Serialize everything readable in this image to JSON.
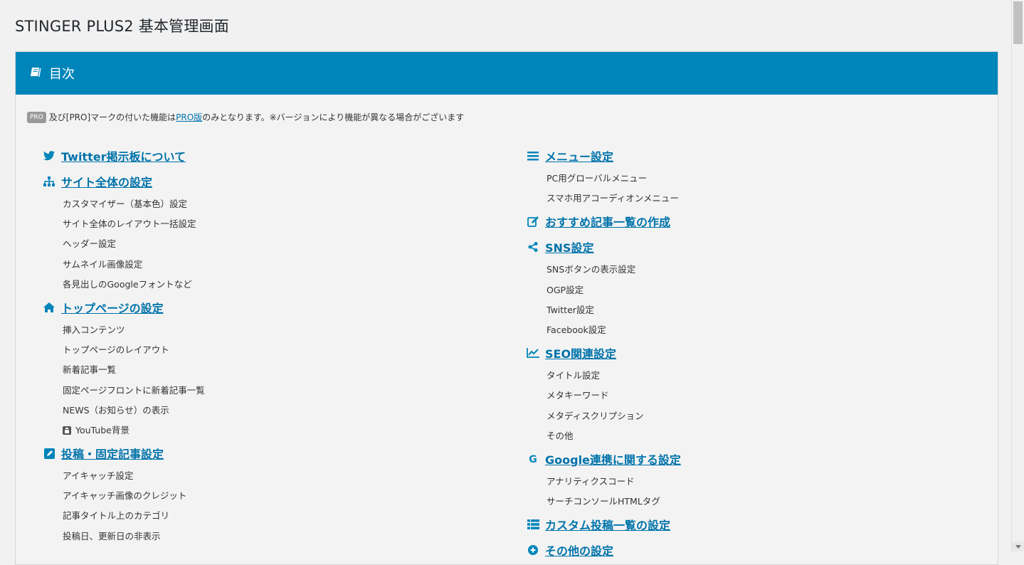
{
  "title": "STINGER PLUS2 基本管理画面",
  "panel": {
    "header": "目次",
    "header_icon": "book-icon"
  },
  "note": {
    "badge": "PRO",
    "text_before": "及び[PRO]マークの付いた機能は",
    "link": "PRO版",
    "text_after": "のみとなります。※バージョンにより機能が異なる場合がございます"
  },
  "colors": {
    "accent": "#0085ba",
    "link": "#0073aa",
    "background": "#f1f1f1"
  },
  "left": [
    {
      "label": "Twitter掲示板について",
      "icon": "twitter-icon",
      "items": []
    },
    {
      "label": "サイト全体の設定",
      "icon": "sitemap-icon",
      "items": [
        "カスタマイザー（基本色）設定",
        "サイト全体のレイアウト一括設定",
        "ヘッダー設定",
        "サムネイル画像設定",
        "各見出しのGoogleフォントなど"
      ]
    },
    {
      "label": "トップページの設定",
      "icon": "home-icon",
      "items": [
        "挿入コンテンツ",
        "トップページのレイアウト",
        "新着記事一覧",
        "固定ページフロントに新着記事一覧",
        "NEWS（お知らせ）の表示",
        "YouTube背景"
      ]
    },
    {
      "label": "投稿・固定記事設定",
      "icon": "edit-icon",
      "items": [
        "アイキャッチ設定",
        "アイキャッチ画像のクレジット",
        "記事タイトル上のカテゴリ",
        "投稿日、更新日の非表示"
      ]
    }
  ],
  "right": [
    {
      "label": "メニュー設定",
      "icon": "menu-icon",
      "items": [
        "PC用グローバルメニュー",
        "スマホ用アコーディオンメニュー"
      ]
    },
    {
      "label": "おすすめ記事一覧の作成",
      "icon": "pencil-square-icon",
      "items": []
    },
    {
      "label": "SNS設定",
      "icon": "share-icon",
      "items": [
        "SNSボタンの表示設定",
        "OGP設定",
        "Twitter設定",
        "Facebook設定"
      ]
    },
    {
      "label": "SEO関連設定",
      "icon": "line-chart-icon",
      "items": [
        "タイトル設定",
        "メタキーワード",
        "メタディスクリプション",
        "その他"
      ]
    },
    {
      "label": "Google連携に関する設定",
      "icon": "google-icon",
      "items": [
        "アナリティクスコード",
        "サーチコンソールHTMLタグ"
      ]
    },
    {
      "label": "カスタム投稿一覧の設定",
      "icon": "list-icon",
      "items": []
    },
    {
      "label": "その他の設定",
      "icon": "plus-circle-icon",
      "items": []
    }
  ]
}
